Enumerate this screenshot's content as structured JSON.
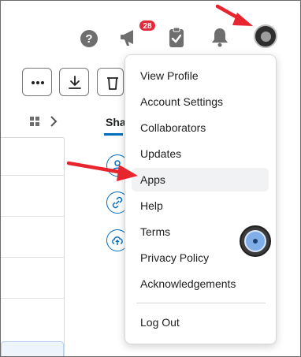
{
  "header": {
    "notification_count": "28",
    "icons": [
      "help-icon",
      "notification-icon",
      "task-icon",
      "bell-icon",
      "avatar"
    ]
  },
  "toolbar": {
    "icons": [
      "more-icon",
      "download-icon",
      "trash-icon"
    ]
  },
  "side_panel": {
    "tab_label": "Sha",
    "accent_color": "#006fbf"
  },
  "menu": {
    "items": [
      {
        "label": "View Profile"
      },
      {
        "label": "Account Settings"
      },
      {
        "label": "Collaborators"
      },
      {
        "label": "Updates"
      },
      {
        "label": "Apps",
        "highlighted": true
      },
      {
        "label": "Help"
      },
      {
        "label": "Terms"
      },
      {
        "label": "Privacy Policy"
      },
      {
        "label": "Acknowledgements"
      }
    ],
    "logout_label": "Log Out"
  },
  "annotations": {
    "arrow_color": "#e8252f"
  }
}
